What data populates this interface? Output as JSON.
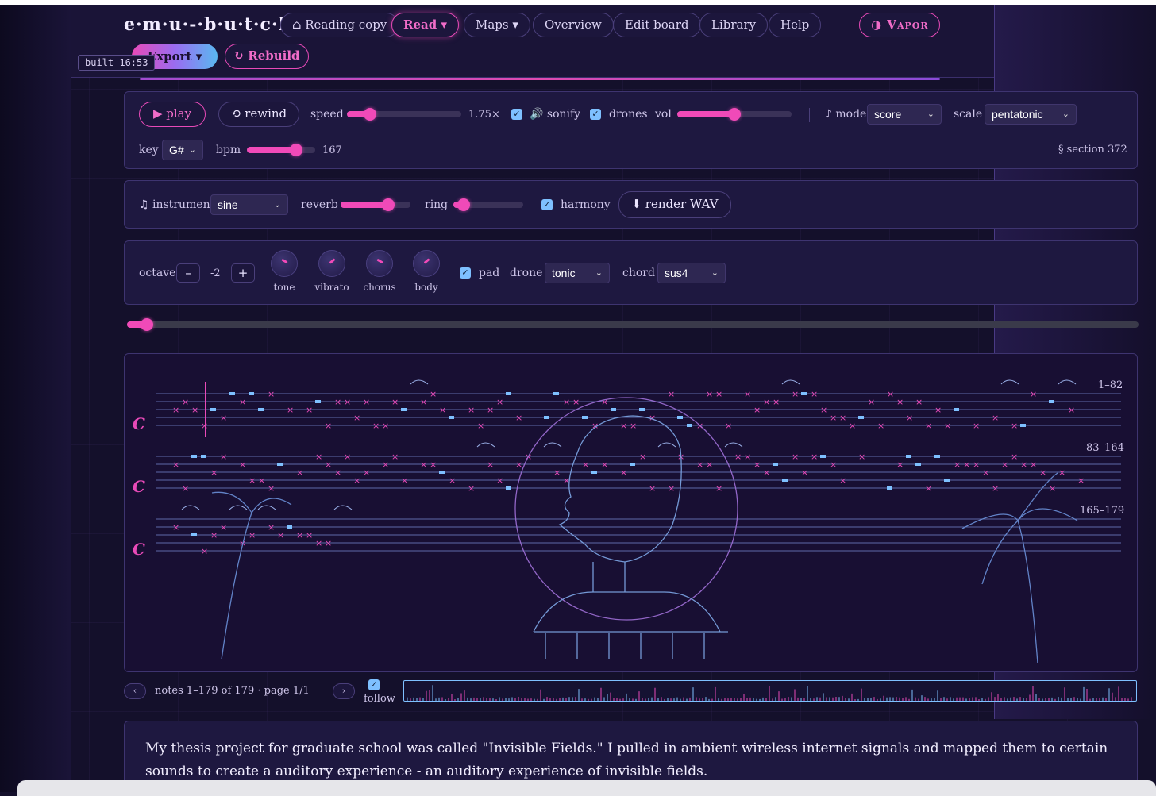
{
  "brand": "e·m·u·-·b·u·t·c·h",
  "nav": {
    "reading_copy": "⌂ Reading copy",
    "read": "Read ▾",
    "maps": "Maps ▾",
    "overview": "Overview",
    "edit_board": "Edit board",
    "library": "Library",
    "help": "Help",
    "theme": "◑ Vapor"
  },
  "toolbar": {
    "export": "Export ▾",
    "rebuild": "↻ Rebuild",
    "built": "built 16:53"
  },
  "transport": {
    "play": "▶ play",
    "rewind": "⟲ rewind",
    "speed_label": "speed",
    "speed_value": "1.75×",
    "speed_level": 0.2,
    "sonify_label": "🔊 sonify",
    "sonify_checked": true,
    "drones_label": "drones",
    "drones_checked": true,
    "vol_label": "vol",
    "vol_level": 0.5,
    "mode_label": "♪ mode",
    "mode_value": "score",
    "scale_label": "scale",
    "scale_value": "pentatonic",
    "key_label": "key",
    "key_value": "G#",
    "bpm_label": "bpm",
    "bpm_value": "167",
    "bpm_level": 0.72,
    "section": "§ section 372"
  },
  "synth": {
    "instrument_label": "♫ instrument",
    "instrument_value": "sine",
    "reverb_label": "reverb",
    "reverb_level": 0.68,
    "ring_label": "ring",
    "ring_level": 0.15,
    "harmony_label": "harmony",
    "harmony_checked": true,
    "render": "⬇ render WAV"
  },
  "voice": {
    "octave_label": "octave",
    "octave_minus": "–",
    "octave_value": "-2",
    "octave_plus": "+",
    "knobs": [
      "tone",
      "vibrato",
      "chorus",
      "body"
    ],
    "pad_label": "pad",
    "pad_checked": true,
    "drone_label": "drone",
    "drone_value": "tonic",
    "chord_label": "chord",
    "chord_value": "sus4"
  },
  "position_level": 0.02,
  "score": {
    "clef": "C",
    "ranges": [
      "1–82",
      "83–164",
      "165–179"
    ]
  },
  "pager": {
    "prev": "‹",
    "next": "›",
    "info": "notes 1–179 of 179 · page 1/1",
    "follow_label": "follow",
    "follow_checked": true
  },
  "prose": "My thesis project for graduate school was called \"Invisible Fields.\" I pulled in ambient wireless internet signals and mapped them to certain sounds to create a auditory experience - an auditory experience of invisible fields.",
  "colors": {
    "accent": "#e84ab8",
    "cyan": "#7ec0ff",
    "bg": "#14102b"
  }
}
